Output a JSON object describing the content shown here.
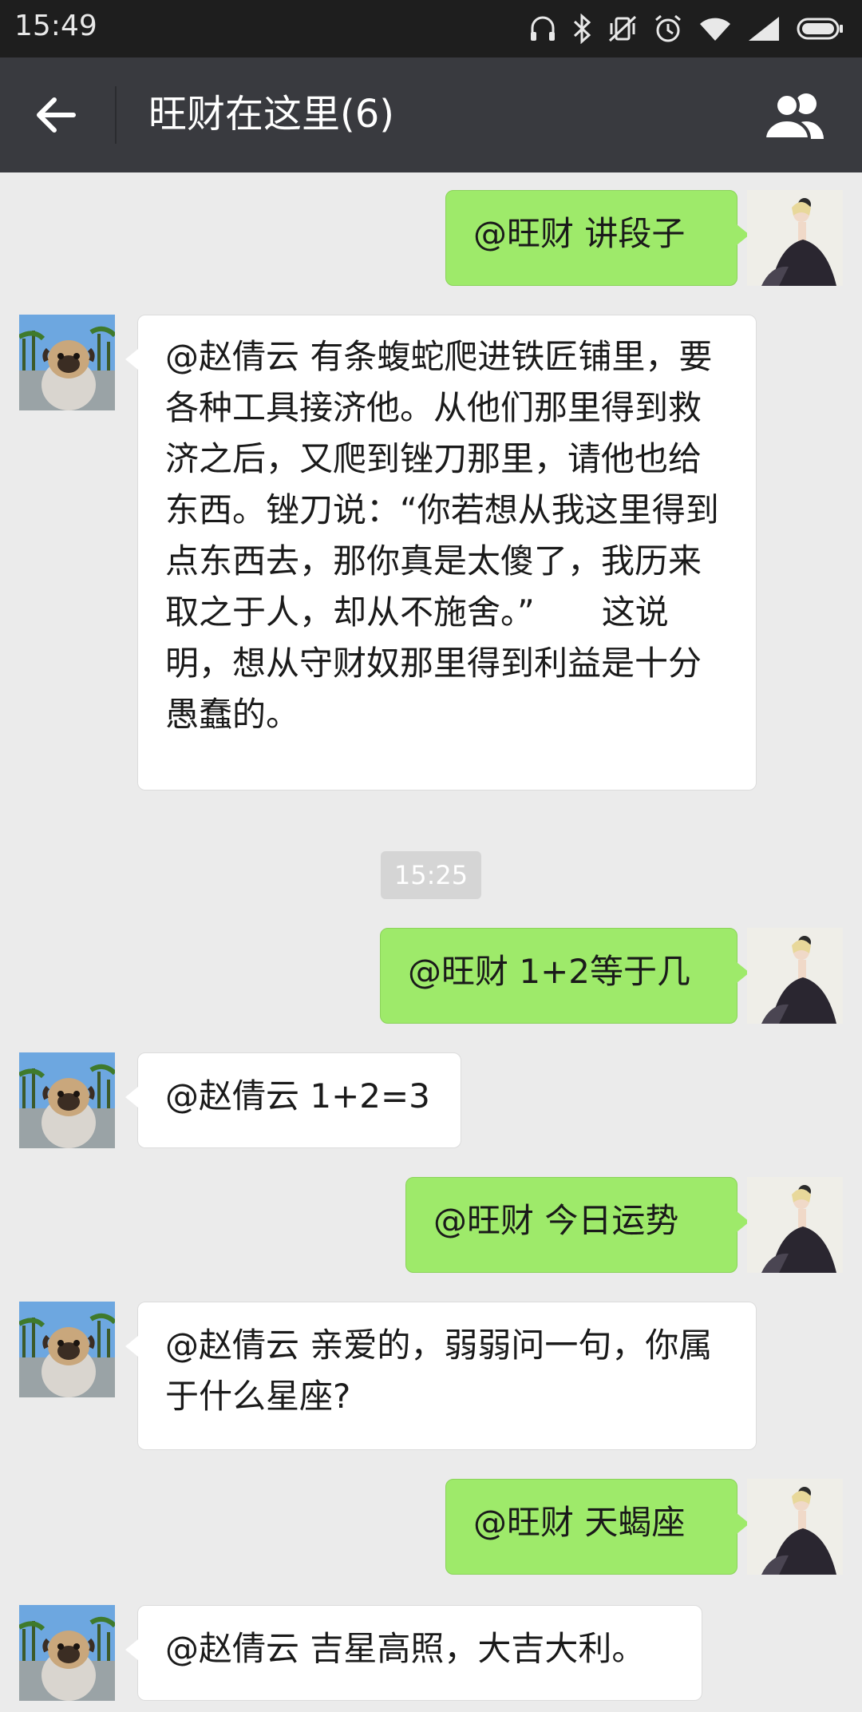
{
  "status_bar": {
    "time": "15:49",
    "icons": [
      "headset-icon",
      "bluetooth-icon",
      "vibrate-off-icon",
      "alarm-icon",
      "wifi-icon",
      "signal-icon",
      "battery-icon"
    ]
  },
  "header": {
    "title": "旺财在这里(6)",
    "back_icon": "back-arrow-icon",
    "members_icon": "group-members-icon",
    "background": "#393a3f"
  },
  "chat": {
    "colors": {
      "outgoing_bubble": "#9eea6a",
      "incoming_bubble": "#ffffff",
      "background": "#ebebeb"
    },
    "messages": [
      {
        "sender": "me",
        "text": "@旺财 讲段子"
      },
      {
        "sender": "bot",
        "text": "@赵倩云 有条蝮蛇爬进铁匠铺里，要各种工具接济他。从他们那里得到救济之后，又爬到锉刀那里，请他也给东西。锉刀说：“你若想从我这里得到点东西去，那你真是太傻了，我历来取之于人，却从不施舍。”　　这说明，想从守财奴那里得到利益是十分愚蠢的。"
      },
      {
        "timestamp": "15:25"
      },
      {
        "sender": "me",
        "text": "@旺财 1+2等于几"
      },
      {
        "sender": "bot",
        "text": "@赵倩云 1+2=3"
      },
      {
        "sender": "me",
        "text": "@旺财 今日运势"
      },
      {
        "sender": "bot",
        "text": "@赵倩云 亲爱的，弱弱问一句，你属于什么星座?"
      },
      {
        "sender": "me",
        "text": "@旺财 天蝎座"
      },
      {
        "sender": "bot",
        "text": "@赵倩云 吉星高照，大吉大利。"
      }
    ]
  }
}
